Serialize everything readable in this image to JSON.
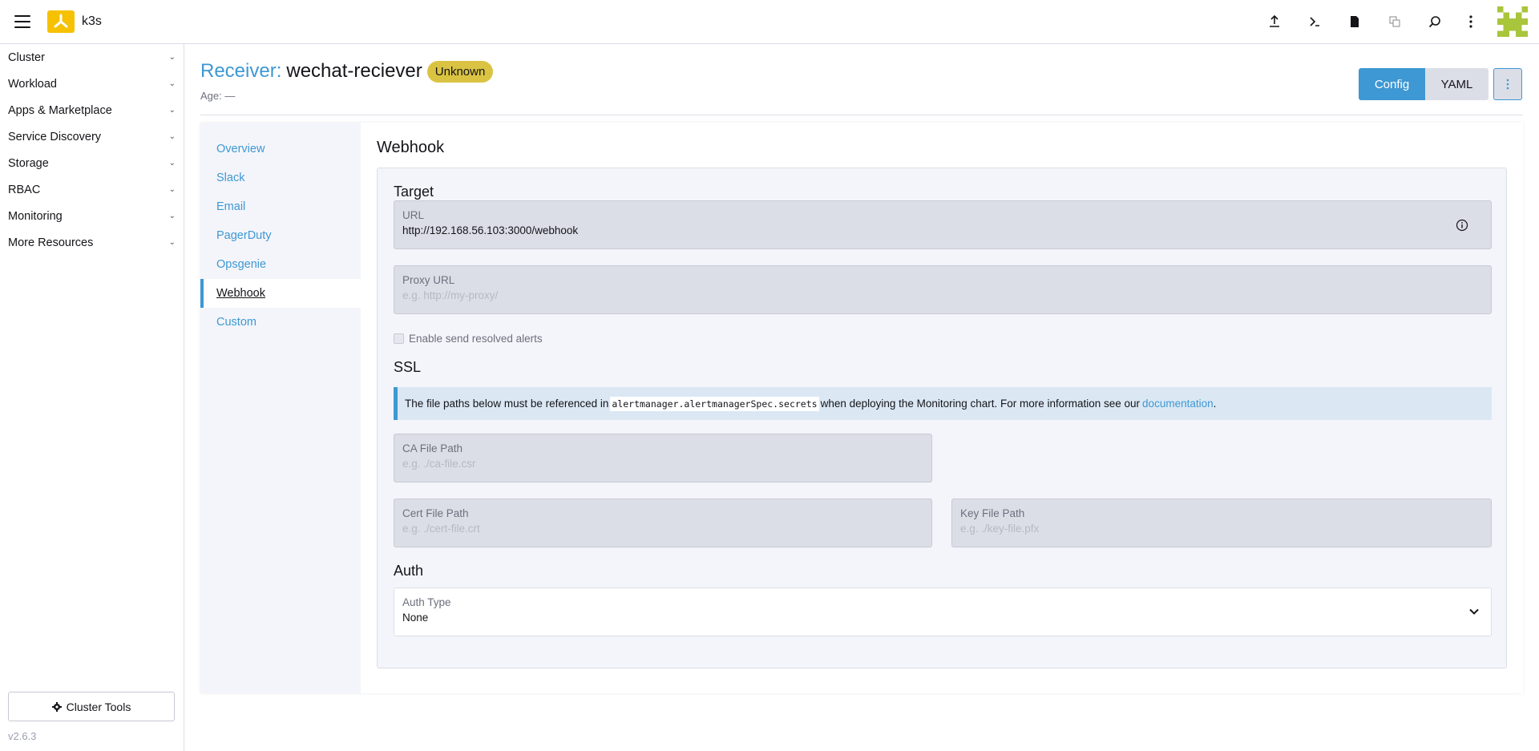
{
  "header": {
    "app_name": "k3s",
    "icons": [
      "upload-icon",
      "terminal-icon",
      "file-icon",
      "copy-icon",
      "search-icon",
      "more-vertical-icon"
    ],
    "brand_color": "#f6c100"
  },
  "sidebar": {
    "groups": [
      {
        "label": "Cluster"
      },
      {
        "label": "Workload"
      },
      {
        "label": "Apps & Marketplace"
      },
      {
        "label": "Service Discovery"
      },
      {
        "label": "Storage"
      },
      {
        "label": "RBAC"
      },
      {
        "label": "Monitoring"
      },
      {
        "label": "More Resources"
      }
    ],
    "cluster_tools_label": "Cluster Tools",
    "version": "v2.6.3"
  },
  "page": {
    "title_label": "Receiver:",
    "title_name": "wechat-reciever",
    "status": "Unknown",
    "age_label": "Age:",
    "age_value": "—",
    "config_label": "Config",
    "yaml_label": "YAML",
    "accent_color": "#3d98d3"
  },
  "tabs": [
    {
      "label": "Overview"
    },
    {
      "label": "Slack"
    },
    {
      "label": "Email"
    },
    {
      "label": "PagerDuty"
    },
    {
      "label": "Opsgenie"
    },
    {
      "label": "Webhook",
      "active": true
    },
    {
      "label": "Custom"
    }
  ],
  "webhook": {
    "section_title": "Webhook",
    "target_title": "Target",
    "url_label": "URL",
    "url_value": "http://192.168.56.103:3000/webhook",
    "proxy_label": "Proxy URL",
    "proxy_placeholder": "e.g. http://my-proxy/",
    "resolved_label": "Enable send resolved alerts",
    "ssl_title": "SSL",
    "banner_pre": "The file paths below must be referenced in",
    "banner_code": "alertmanager.alertmanagerSpec.secrets",
    "banner_post": "when deploying the Monitoring chart. For more information see our",
    "banner_link": "documentation",
    "banner_end": ".",
    "ca_label": "CA File Path",
    "ca_placeholder": "e.g. ./ca-file.csr",
    "cert_label": "Cert File Path",
    "cert_placeholder": "e.g. ./cert-file.crt",
    "key_label": "Key File Path",
    "key_placeholder": "e.g. ./key-file.pfx",
    "auth_title": "Auth",
    "auth_type_label": "Auth Type",
    "auth_type_value": "None"
  }
}
